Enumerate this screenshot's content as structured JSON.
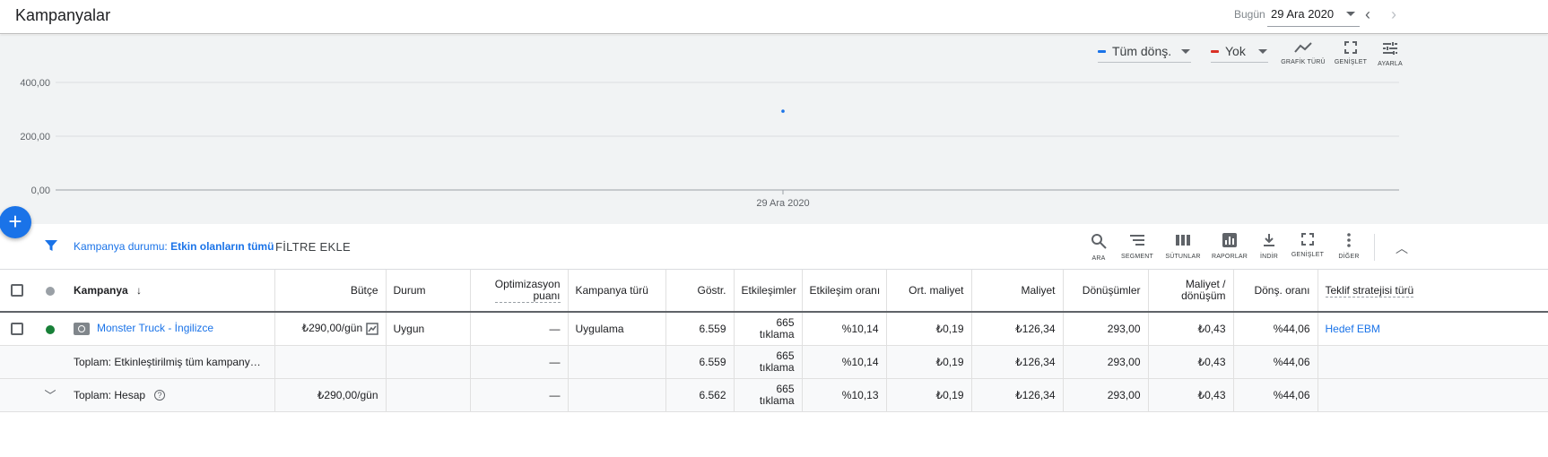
{
  "header": {
    "title": "Kampanyalar",
    "date_label": "Bugün",
    "date_value": "29 Ara 2020",
    "prev_icon": "chevron-left-icon",
    "next_icon": "chevron-right-icon"
  },
  "chart": {
    "metric1": {
      "label": "Tüm dönş.",
      "color": "#1a73e8"
    },
    "metric2": {
      "label": "Yok",
      "color": "#d93025"
    },
    "tools": [
      {
        "label": "GRAFİK TÜRÜ",
        "icon": "line-chart-icon"
      },
      {
        "label": "GENİŞLET",
        "icon": "expand-icon"
      },
      {
        "label": "AYARLA",
        "icon": "tune-icon"
      }
    ]
  },
  "chart_data": {
    "type": "line",
    "x": [
      "29 Ara 2020"
    ],
    "series": [
      {
        "name": "Tüm dönş.",
        "values": [
          293.0
        ]
      }
    ],
    "yticks": [
      "400,00",
      "200,00",
      "0,00"
    ],
    "ylim": [
      0,
      400
    ],
    "grid": true
  },
  "filter": {
    "prefix": "Kampanya durumu: ",
    "value": "Etkin olanların tümü",
    "add_label": "FİLTRE EKLE"
  },
  "table_tools": [
    {
      "label": "ARA",
      "icon": "search-icon"
    },
    {
      "label": "SEGMENT",
      "icon": "segment-icon"
    },
    {
      "label": "SÜTUNLAR",
      "icon": "columns-icon"
    },
    {
      "label": "RAPORLAR",
      "icon": "reports-icon"
    },
    {
      "label": "İNDİR",
      "icon": "download-icon"
    },
    {
      "label": "GENİŞLET",
      "icon": "fullscreen-icon"
    },
    {
      "label": "DİĞER",
      "icon": "more-vert-icon"
    }
  ],
  "columns": {
    "campaign": "Kampanya",
    "budget": "Bütçe",
    "status": "Durum",
    "opt_score_1": "Optimizasyon",
    "opt_score_2": "puanı",
    "campaign_type": "Kampanya türü",
    "impressions": "Göstr.",
    "interactions": "Etkileşimler",
    "interaction_rate": "Etkileşim oranı",
    "avg_cost": "Ort. maliyet",
    "cost": "Maliyet",
    "conversions": "Dönüşümler",
    "cost_per_conv_1": "Maliyet /",
    "cost_per_conv_2": "dönüşüm",
    "conv_rate": "Dönş. oranı",
    "bid_strategy": "Teklif stratejisi türü"
  },
  "rows": {
    "campaign": {
      "status_color": "#188038",
      "name": "Monster Truck - İngilizce",
      "budget": "₺290,00/gün",
      "status": "Uygun",
      "opt_score": "—",
      "type": "Uygulama",
      "impressions": "6.559",
      "interactions_1": "665",
      "interactions_2": "tıklama",
      "interaction_rate": "%10,14",
      "avg_cost": "₺0,19",
      "cost": "₺126,34",
      "conversions": "293,00",
      "cost_per_conv": "₺0,43",
      "conv_rate": "%44,06",
      "bid_strategy": "Hedef EBM"
    },
    "total_enabled": {
      "name": "Toplam: Etkinleştirilmiş tüm kampany…",
      "opt_score": "—",
      "impressions": "6.559",
      "interactions_1": "665",
      "interactions_2": "tıklama",
      "interaction_rate": "%10,14",
      "avg_cost": "₺0,19",
      "cost": "₺126,34",
      "conversions": "293,00",
      "cost_per_conv": "₺0,43",
      "conv_rate": "%44,06"
    },
    "total_account": {
      "name": "Toplam: Hesap",
      "budget": "₺290,00/gün",
      "opt_score": "—",
      "impressions": "6.562",
      "interactions_1": "665",
      "interactions_2": "tıklama",
      "interaction_rate": "%10,13",
      "avg_cost": "₺0,19",
      "cost": "₺126,34",
      "conversions": "293,00",
      "cost_per_conv": "₺0,43",
      "conv_rate": "%44,06"
    }
  }
}
